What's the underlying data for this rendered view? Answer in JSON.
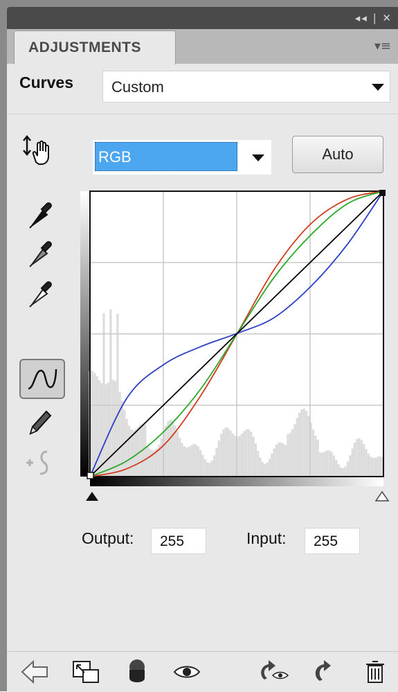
{
  "panel": {
    "title_controls": "◂◂ | ✕",
    "tab_label": "ADJUSTMENTS",
    "menu_glyph": "▾≡",
    "adjustment_name": "Curves",
    "preset_value": "Custom",
    "channel_value": "RGB",
    "auto_label": "Auto",
    "output_label": "Output:",
    "output_value": "255",
    "input_label": "Input:",
    "input_value": "255"
  },
  "colors": {
    "channel_highlight": "#4da6f0",
    "red_curve": "#d23c1e",
    "green_curve": "#2aa82a",
    "blue_curve": "#2a3fc8",
    "rgb_curve": "#000000"
  },
  "icons": {
    "left_tools": [
      "on-image-adjust-icon",
      "black-point-eyedropper-icon",
      "gray-point-eyedropper-icon",
      "white-point-eyedropper-icon",
      "curve-edit-icon",
      "pencil-icon",
      "smooth-icon"
    ],
    "bottom_bar": [
      "back-arrow-icon",
      "expand-view-icon",
      "clip-layer-icon",
      "visibility-eye-icon",
      "previous-state-icon",
      "reset-icon",
      "trash-icon"
    ]
  },
  "chart_data": {
    "type": "line",
    "xlim": [
      0,
      255
    ],
    "ylim": [
      0,
      255
    ],
    "grid": true,
    "series": [
      {
        "color": "red",
        "x": [
          0,
          32,
          64,
          96,
          128,
          160,
          192,
          224,
          255
        ],
        "y": [
          0,
          7,
          28,
          72,
          128,
          185,
          226,
          248,
          255
        ]
      },
      {
        "color": "green",
        "x": [
          0,
          32,
          64,
          96,
          128,
          160,
          192,
          224,
          255
        ],
        "y": [
          0,
          14,
          40,
          78,
          128,
          178,
          216,
          244,
          255
        ]
      },
      {
        "color": "blue",
        "x": [
          0,
          32,
          64,
          96,
          128,
          160,
          192,
          224,
          255
        ],
        "y": [
          0,
          70,
          100,
          116,
          128,
          142,
          170,
          208,
          255
        ]
      },
      {
        "color": "black",
        "x": [
          0,
          255
        ],
        "y": [
          0,
          255
        ]
      }
    ]
  }
}
